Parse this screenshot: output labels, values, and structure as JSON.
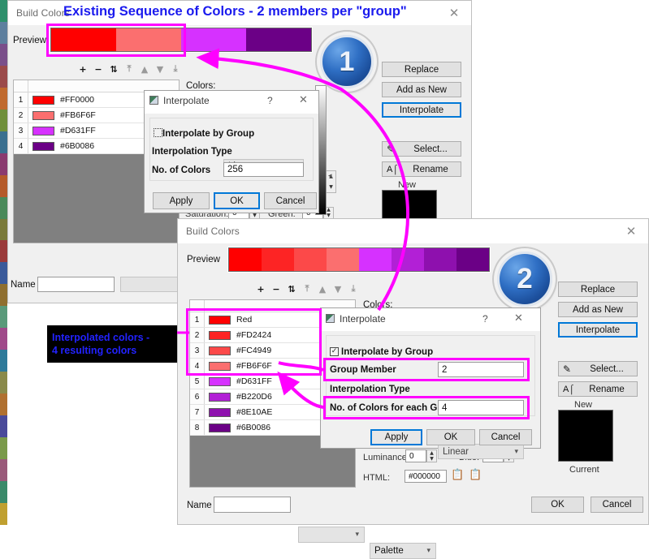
{
  "banner": {
    "text": "Existing Sequence of Colors - 2 members per \"group\""
  },
  "badges": {
    "one": "1",
    "two": "2"
  },
  "note": {
    "line1": "Interpolated colors -",
    "line2": "4 resulting colors"
  },
  "left_strip_colors": [
    "#2f8f6b",
    "#5e7f9e",
    "#7a4f8a",
    "#9b4a4a",
    "#c06a2e",
    "#6f8f3a",
    "#3a6f8f",
    "#8a3a6f",
    "#b55a2a",
    "#4a8a5a",
    "#7a7a3a",
    "#9a3a3a",
    "#3a5a9a",
    "#8f6f2f",
    "#5a9a7a",
    "#a04a8a",
    "#2e7a9a",
    "#8a8a4a",
    "#b07030",
    "#4a4a9a",
    "#7a9a4a",
    "#9a5a7a",
    "#3a8a6a",
    "#c0a030"
  ],
  "dialog1": {
    "title": "Build Colors",
    "close_icon": "close-icon",
    "preview_label": "Preview",
    "preview_bands": [
      "#FF0000",
      "#FB6F6F",
      "#D631FF",
      "#6B0086"
    ],
    "toolbar": [
      "+",
      "−",
      "⇅",
      "⤒",
      "▲",
      "▼",
      "⤓"
    ],
    "colors_label": "Colors:",
    "rows": [
      {
        "index": "1",
        "color": "#FF0000",
        "name": "#FF0000"
      },
      {
        "index": "2",
        "color": "#FB6F6F",
        "name": "#FB6F6F"
      },
      {
        "index": "3",
        "color": "#D631FF",
        "name": "#D631FF"
      },
      {
        "index": "4",
        "color": "#6B0086",
        "name": "#6B0086"
      }
    ],
    "buttons": {
      "replace": "Replace",
      "add_as_new": "Add as New",
      "interpolate": "Interpolate",
      "select": "Select...",
      "rename": "Rename"
    },
    "new_label": "New",
    "name_label": "Name",
    "name_value": "",
    "fields": {
      "saturation_label": "Saturation:",
      "saturation_value": "0",
      "green_label": "Green:",
      "green_value": "0"
    }
  },
  "interpolate1": {
    "title": "Interpolate",
    "help_icon": "?",
    "close_icon": "close-icon",
    "by_group_label": "Interpolate by Group",
    "by_group_checked": false,
    "type_label": "Interpolation Type",
    "type_value": "Linear",
    "count_label": "No. of Colors",
    "count_value": "256",
    "apply": "Apply",
    "ok": "OK",
    "cancel": "Cancel"
  },
  "dialog2": {
    "title": "Build Colors",
    "close_icon": "close-icon",
    "preview_label": "Preview",
    "preview_bands": [
      "#FF0000",
      "#FD2424",
      "#FC4949",
      "#FB6F6F",
      "#D631FF",
      "#B220D6",
      "#8E10AE",
      "#6B0086"
    ],
    "toolbar": [
      "+",
      "−",
      "⇅",
      "⤒",
      "▲",
      "▼",
      "⤓"
    ],
    "colors_label": "Colors:",
    "rows": [
      {
        "index": "1",
        "color": "#FF0000",
        "name": "Red"
      },
      {
        "index": "2",
        "color": "#FD2424",
        "name": "#FD2424"
      },
      {
        "index": "3",
        "color": "#FC4949",
        "name": "#FC4949"
      },
      {
        "index": "4",
        "color": "#FB6F6F",
        "name": "#FB6F6F"
      },
      {
        "index": "5",
        "color": "#D631FF",
        "name": "#D631FF"
      },
      {
        "index": "6",
        "color": "#B220D6",
        "name": "#B220D6"
      },
      {
        "index": "7",
        "color": "#8E10AE",
        "name": "#8E10AE"
      },
      {
        "index": "8",
        "color": "#6B0086",
        "name": "#6B0086"
      }
    ],
    "buttons": {
      "replace": "Replace",
      "add_as_new": "Add as New",
      "interpolate": "Interpolate",
      "select": "Select...",
      "rename": "Rename",
      "ok": "OK",
      "cancel": "Cancel"
    },
    "new_label": "New",
    "current_label": "Current",
    "name_label": "Name",
    "name_value": "",
    "palette_combo": "Palette",
    "blank_combo": "",
    "fields": {
      "luminance_label": "Luminance:",
      "luminance_value": "0",
      "blue_label": "Blue:",
      "blue_value": "0",
      "html_label": "HTML:",
      "html_value": "#000000",
      "copy_icon": "copy-icon",
      "paste_icon": "paste-icon"
    }
  },
  "interpolate2": {
    "title": "Interpolate",
    "help_icon": "?",
    "close_icon": "close-icon",
    "by_group_label": "Interpolate by Group",
    "by_group_checked": true,
    "group_member_label": "Group Member",
    "group_member_value": "2",
    "type_label": "Interpolation Type",
    "type_value": "Linear",
    "count_label": "No. of Colors for each Group",
    "count_value": "4",
    "apply": "Apply",
    "ok": "OK",
    "cancel": "Cancel"
  }
}
